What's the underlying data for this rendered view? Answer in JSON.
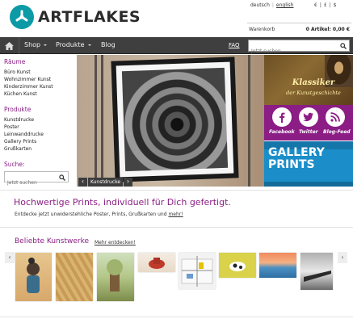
{
  "brand": {
    "name": "ARTFLAKES",
    "color": "#0b9aa6"
  },
  "languages": {
    "de": "deutsch",
    "separator": "|",
    "en": "english"
  },
  "currencies": [
    "€",
    "|",
    "£",
    "|",
    "$"
  ],
  "cart": {
    "label": "Warenkorb",
    "summary": "0 Artikel: 0,00 €"
  },
  "nav": {
    "home_icon": "home-icon",
    "items": [
      {
        "label": "Shop",
        "has_dropdown": true
      },
      {
        "label": "Produkte",
        "has_dropdown": true
      },
      {
        "label": "Blog",
        "has_dropdown": false
      }
    ],
    "faq": "FAQ",
    "search_placeholder": "Jetzt suchen"
  },
  "sidebar": {
    "rooms_heading": "Räume",
    "rooms": [
      "Büro Kunst",
      "Wohnzimmer Kunst",
      "Kinderzimmer Kunst",
      "Küchen Kunst"
    ],
    "products_heading": "Produkte",
    "products": [
      "Kunstdrucke",
      "Poster",
      "Leinwanddrucke",
      "Gallery Prints",
      "Grußkarten"
    ],
    "search_heading": "Suche:",
    "search_placeholder": "Jetzt suchen"
  },
  "hero": {
    "tag": "Kunstdrucke",
    "prev": "‹",
    "next": "›"
  },
  "promos": {
    "classic_title": "Klassiker",
    "classic_sub": "der Kunstgeschichte",
    "social": [
      {
        "label": "Facebook",
        "icon": "facebook-icon"
      },
      {
        "label": "Twitter",
        "icon": "twitter-icon"
      },
      {
        "label": "Blog-Feed",
        "icon": "rss-icon"
      }
    ],
    "gallery_line1": "GALLERY",
    "gallery_line2": "PRINTS"
  },
  "headline": {
    "title": "Hochwertige Prints, individuell für Dich gefertigt.",
    "sub_text": "Entdecke jetzt unwiderstehliche Poster, Prints, Grußkarten und",
    "sub_link": "mehr!"
  },
  "popular": {
    "heading": "Beliebte Kunstwerke",
    "more": "Mehr entdecken!",
    "prev": "‹",
    "next": "›"
  },
  "colors": {
    "accent": "#8a1f85",
    "nav_bg": "#3f3f3f",
    "gallery_blue": "#1b8ec9"
  }
}
